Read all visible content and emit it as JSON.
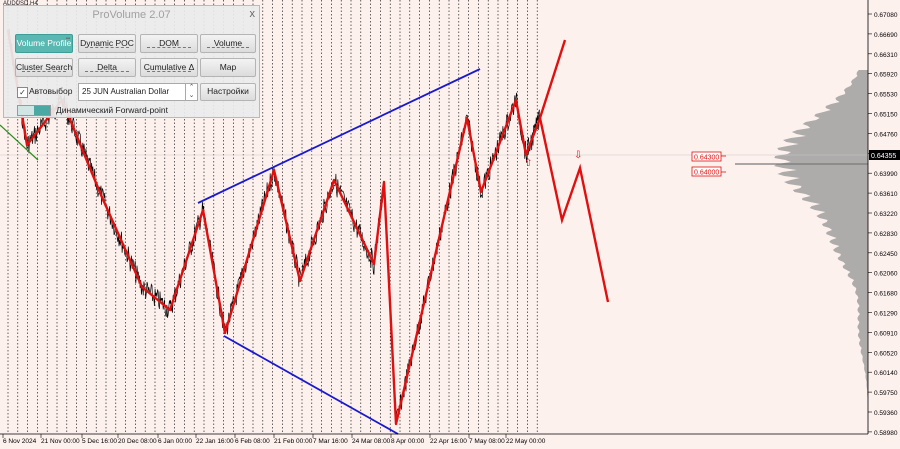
{
  "chart": {
    "symbol": "AUDUSD,H4",
    "price_labels": [
      "0.67080",
      "0.66690",
      "0.66310",
      "0.65920",
      "0.65530",
      "0.65150",
      "0.64760",
      "0.64355",
      "0.63990",
      "0.63610",
      "0.63220",
      "0.62830",
      "0.62450",
      "0.62060",
      "0.61680",
      "0.61290",
      "0.60910",
      "0.60520",
      "0.60140",
      "0.59750",
      "0.59360",
      "0.58980"
    ],
    "current_price": "0.64355",
    "level_labels": [
      "0.64300",
      "0.64000"
    ],
    "time_labels": [
      "6 Nov 2024",
      "21 Nov 00:00",
      "5 Dec 16:00",
      "20 Dec 08:00",
      "6 Jan 00:00",
      "22 Jan 16:00",
      "6 Feb 08:00",
      "21 Feb 00:00",
      "7 Mar 16:00",
      "24 Mar 08:00",
      "8 Apr 00:00",
      "22 Apr 16:00",
      "7 May 08:00",
      "22 May 00:00"
    ],
    "colors": {
      "zigzag": "#e01010",
      "channel": "#1a1acc",
      "profile": "#9a9a9a",
      "background": "#fdf1ee"
    }
  },
  "panel": {
    "title": "ProVolume 2.07",
    "close": "x",
    "buttons": {
      "volume_profile": "Volume Profile",
      "dynamic_poc": "Dynamic POC",
      "dom": "DOM",
      "volume": "Volume",
      "cluster_search": "Cluster Search",
      "delta": "Delta",
      "cumulative_delta": "Cumulative Δ",
      "map": "Map",
      "settings": "Настройки"
    },
    "auto_select_label": "Автовыбор",
    "auto_select_checked": true,
    "instrument_select": "25 JUN Australian Dollar",
    "forward_point_label": "Динамический Forward-point"
  }
}
